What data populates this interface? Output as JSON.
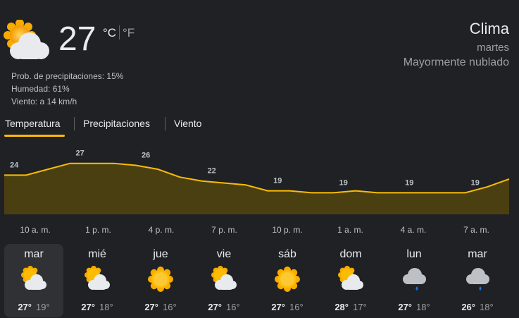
{
  "current": {
    "temp": "27",
    "unit_c": "°C",
    "unit_f": "°F",
    "icon": "partly-cloudy-day-icon",
    "details": [
      "Prob. de precipitaciones: 15%",
      "Humedad: 61%",
      "Viento: a 14 km/h"
    ]
  },
  "header": {
    "title": "Clima",
    "day": "martes",
    "description": "Mayormente nublado"
  },
  "tabs": [
    {
      "label": "Temperatura",
      "active": true
    },
    {
      "label": "Precipitaciones",
      "active": false
    },
    {
      "label": "Viento",
      "active": false
    }
  ],
  "chart_data": {
    "type": "area",
    "unit": "°C",
    "x_labels": [
      "10 a. m.",
      "1 p. m.",
      "4 p. m.",
      "7 p. m.",
      "10 p. m.",
      "1 a. m.",
      "4 a. m.",
      "7 a. m."
    ],
    "labeled_values": [
      24,
      27,
      26,
      22,
      19,
      19,
      19,
      19
    ],
    "values": [
      24,
      24,
      25.5,
      27,
      27,
      27,
      26.5,
      25.5,
      23.5,
      22.5,
      22,
      21.5,
      20,
      20,
      19.5,
      19.5,
      20,
      19.5,
      19.5,
      19.5,
      19.5,
      19.5,
      21,
      23
    ],
    "ylim": [
      14,
      30
    ],
    "colors": {
      "line": "#fbbc04",
      "fill": "#4a3f10"
    }
  },
  "forecast": [
    {
      "day": "mar",
      "icon": "partly-cloudy-icon",
      "high": "27°",
      "low": "19°",
      "selected": true
    },
    {
      "day": "mié",
      "icon": "partly-cloudy-icon",
      "high": "27°",
      "low": "18°",
      "selected": false
    },
    {
      "day": "jue",
      "icon": "sunny-icon",
      "high": "27°",
      "low": "16°",
      "selected": false
    },
    {
      "day": "vie",
      "icon": "partly-cloudy-icon",
      "high": "27°",
      "low": "16°",
      "selected": false
    },
    {
      "day": "sáb",
      "icon": "sunny-icon",
      "high": "27°",
      "low": "16°",
      "selected": false
    },
    {
      "day": "dom",
      "icon": "partly-cloudy-icon",
      "high": "28°",
      "low": "17°",
      "selected": false
    },
    {
      "day": "lun",
      "icon": "rain-icon",
      "high": "27°",
      "low": "18°",
      "selected": false
    },
    {
      "day": "mar",
      "icon": "rain-icon",
      "high": "26°",
      "low": "18°",
      "selected": false
    }
  ]
}
